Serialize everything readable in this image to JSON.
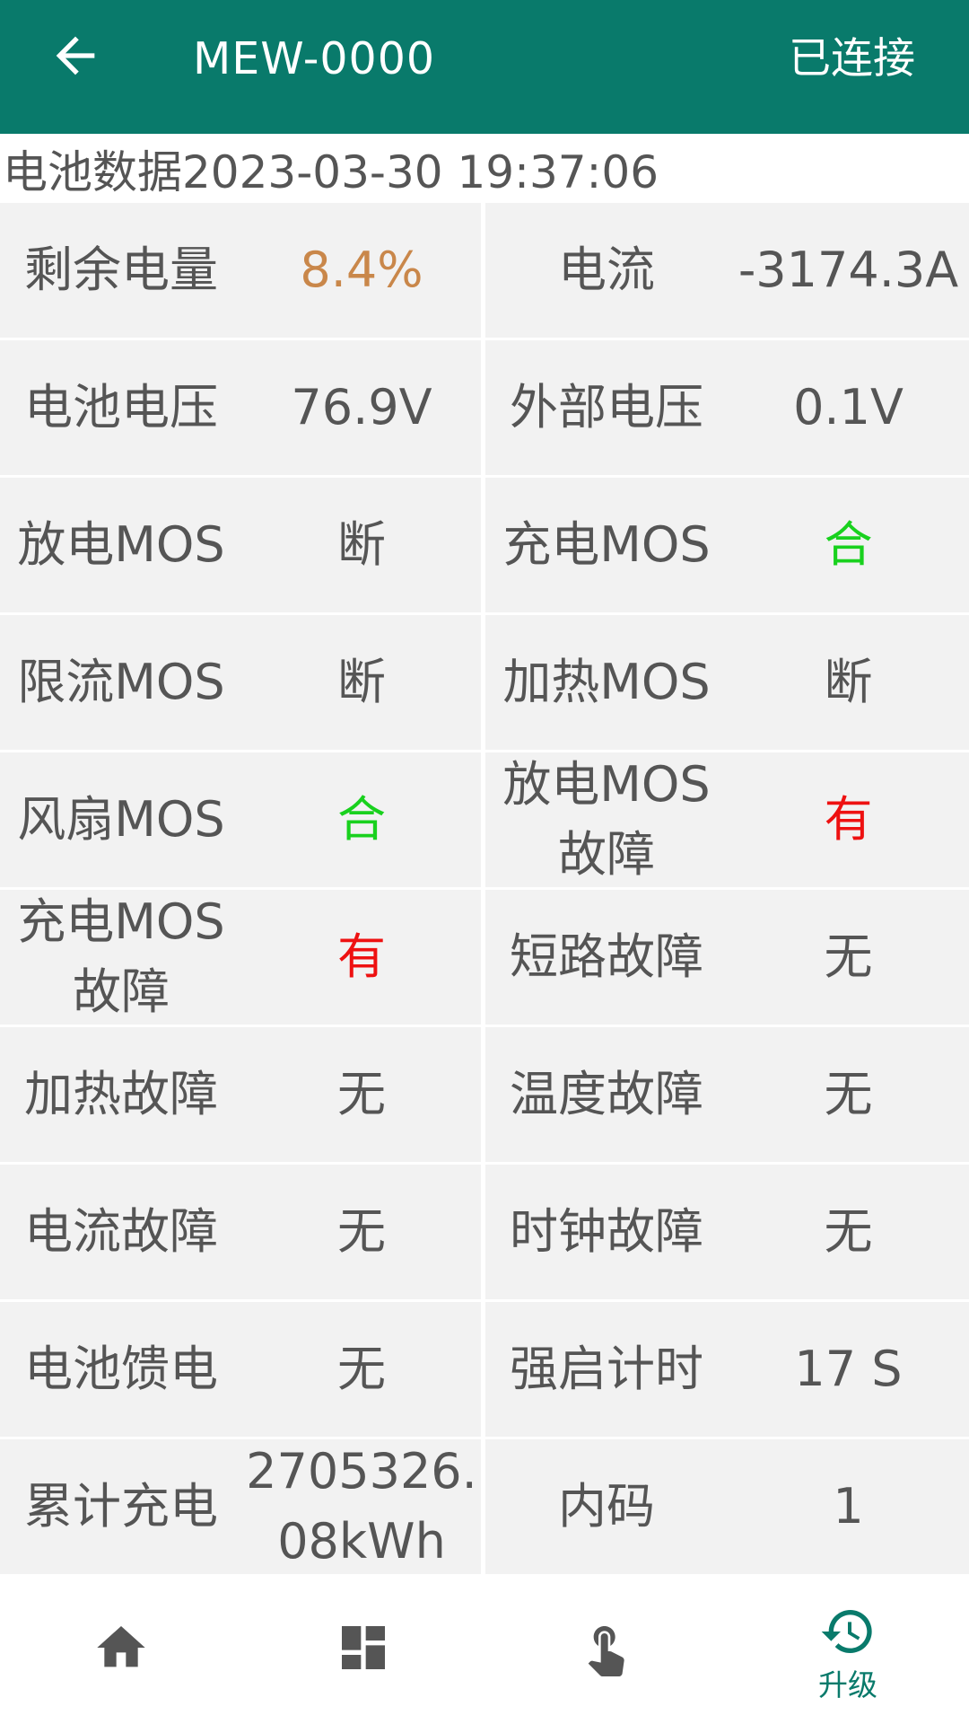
{
  "header": {
    "title": "MEW-0000",
    "status": "已连接",
    "back_icon": "arrow-left-icon"
  },
  "timestamp": "电池数据2023-03-30 19:37:06",
  "colors": {
    "primary": "#097A6B",
    "cell_bg": "#f2f2f2",
    "text": "#555555",
    "orange": "#C9874A",
    "green": "#19D11E",
    "red": "#EE1111"
  },
  "rows": [
    {
      "l1": "剩余电量",
      "v1": "8.4%",
      "l2": "电流",
      "v2": "-3174.3A"
    },
    {
      "l1": "电池电压",
      "v1": "76.9V",
      "l2": "外部电压",
      "v2": "0.1V"
    },
    {
      "l1": "放电MOS",
      "v1": "断",
      "l2": "充电MOS",
      "v2": "合"
    },
    {
      "l1": "限流MOS",
      "v1": "断",
      "l2": "加热MOS",
      "v2": "断"
    },
    {
      "l1": "风扇MOS",
      "v1": "合",
      "l2": "放电MOS\n故障",
      "v2": "有"
    },
    {
      "l1": "充电MOS\n故障",
      "v1": "有",
      "l2": "短路故障",
      "v2": "无"
    },
    {
      "l1": "加热故障",
      "v1": "无",
      "l2": "温度故障",
      "v2": "无"
    },
    {
      "l1": "电流故障",
      "v1": "无",
      "l2": "时钟故障",
      "v2": "无"
    },
    {
      "l1": "电池馈电",
      "v1": "无",
      "l2": "强启计时",
      "v2": "17 S"
    },
    {
      "l1": "累计充电",
      "v1": "2705326.\n08kWh",
      "l2": "内码",
      "v2": "1"
    }
  ],
  "bottom_nav": [
    {
      "icon": "home-icon",
      "label": ""
    },
    {
      "icon": "dashboard-icon",
      "label": ""
    },
    {
      "icon": "touch-icon",
      "label": ""
    },
    {
      "icon": "history-upgrade-icon",
      "label": "升级",
      "active": true
    }
  ]
}
